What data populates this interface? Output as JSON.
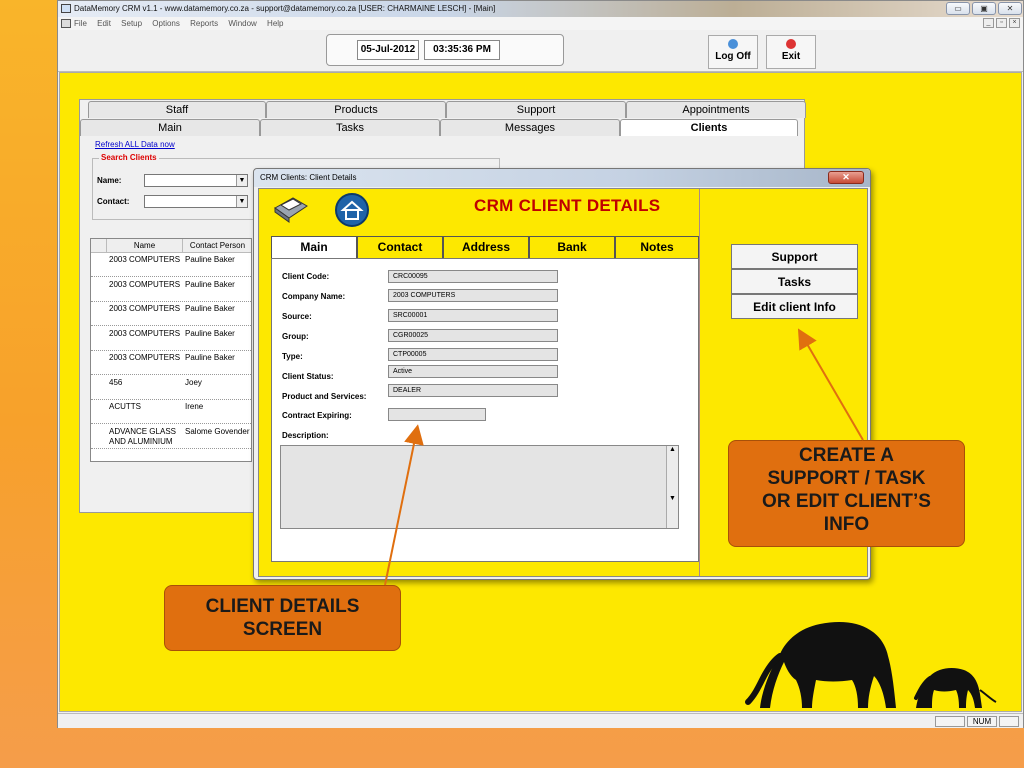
{
  "window": {
    "title": "DataMemory CRM v1.1 - www.datamemory.co.za - support@datamemory.co.za [USER: CHARMAINE LESCH] - [Main]",
    "min_glyph": "▭",
    "max_glyph": "▣",
    "close_glyph": "✕"
  },
  "menu": {
    "items": [
      "File",
      "Edit",
      "Setup",
      "Options",
      "Reports",
      "Window",
      "Help"
    ],
    "mdi_min": "_",
    "mdi_max": "▫",
    "mdi_close": "×"
  },
  "toolbar": {
    "date": "05-Jul-2012",
    "time": "03:35:36 PM",
    "logoff_label": "Log Off",
    "exit_label": "Exit"
  },
  "main_form": {
    "top_tabs": [
      "Staff",
      "Products",
      "Support",
      "Appointments"
    ],
    "bottom_tabs": [
      "Main",
      "Tasks",
      "Messages",
      "Clients"
    ],
    "refresh_link": "Refresh ALL Data now",
    "search_legend": "Search Clients",
    "name_label": "Name:",
    "contact_label": "Contact:",
    "grid": {
      "columns": [
        "Name",
        "Contact Person"
      ],
      "rows": [
        [
          "2003 COMPUTERS",
          "Pauline Baker"
        ],
        [
          "2003 COMPUTERS",
          "Pauline Baker"
        ],
        [
          "2003 COMPUTERS",
          "Pauline Baker"
        ],
        [
          "2003 COMPUTERS",
          "Pauline Baker"
        ],
        [
          "2003 COMPUTERS",
          "Pauline Baker"
        ],
        [
          "456",
          "Joey"
        ],
        [
          "ACUTTS",
          "Irene"
        ],
        [
          "ADVANCE GLASS AND ALUMINIUM",
          "Salome Govender"
        ]
      ]
    }
  },
  "dialog": {
    "title": "CRM Clients: Client Details",
    "close_glyph": "✕",
    "heading": "CRM CLIENT DETAILS",
    "tabs": [
      "Main",
      "Contact",
      "Address",
      "Bank",
      "Notes"
    ],
    "fields": [
      {
        "label": "Client Code:",
        "value": "CRC00095"
      },
      {
        "label": "Company Name:",
        "value": "2003 COMPUTERS"
      },
      {
        "label": "Source:",
        "value": "SRC00001"
      },
      {
        "label": "Group:",
        "value": "CGR00025"
      },
      {
        "label": "Type:",
        "value": "CTP00005"
      },
      {
        "label": "Client Status:",
        "value": "Active"
      },
      {
        "label": "Product and Services:",
        "value": "DEALER"
      },
      {
        "label": "Contract Expiring:",
        "value": ""
      }
    ],
    "description_label": "Description:",
    "side_buttons": [
      "Support",
      "Tasks",
      "Edit client Info"
    ]
  },
  "status": {
    "num": "NUM"
  },
  "callouts": {
    "create": [
      "CREATE A",
      "SUPPORT / TASK",
      "OR EDIT CLIENT’S",
      "INFO"
    ],
    "client": [
      "CLIENT DETAILS",
      "SCREEN"
    ]
  },
  "colors": {
    "mdi_bg": "#fde800",
    "heading_red": "#c00000",
    "callout": "#e06f0f",
    "arrow": "#e06f0f"
  }
}
